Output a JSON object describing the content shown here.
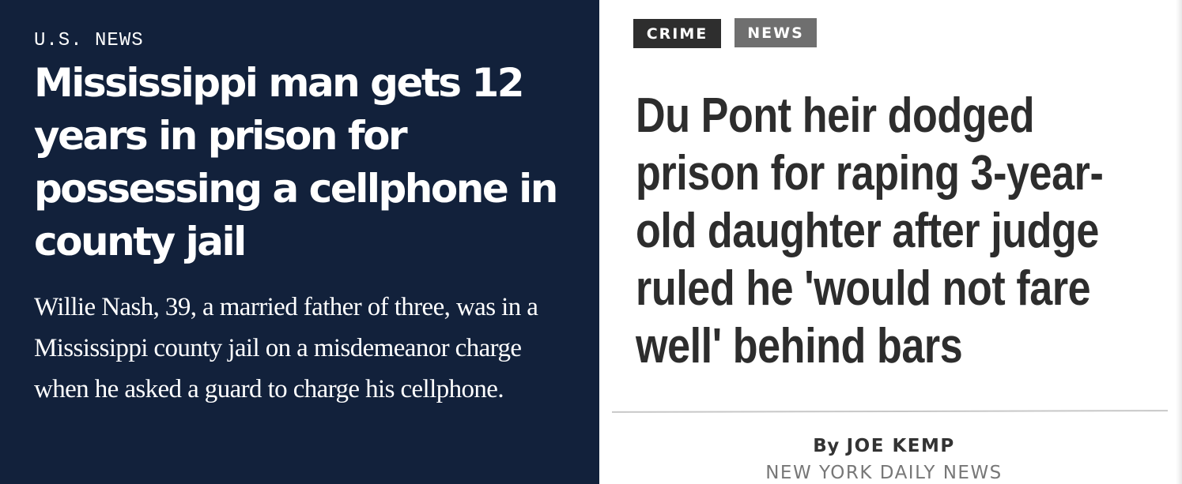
{
  "left_article": {
    "section": "U.S. NEWS",
    "headline": "Mississippi man gets 12 years in prison for possessing a cellphone in county jail",
    "summary": "Willie Nash, 39, a married father of three, was in a Mississippi county jail on a misdemeanor charge when he asked a guard to charge his cellphone."
  },
  "right_article": {
    "tags": [
      "CRIME",
      "NEWS"
    ],
    "headline": "Du Pont heir dodged prison for raping 3-year-old daughter after judge ruled he 'would not fare well' behind bars",
    "byline_prefix": "By",
    "author": "JOE KEMP",
    "source": "NEW YORK DAILY NEWS"
  },
  "colors": {
    "left_background": "#12213b",
    "crime_tag": "#2e2e2e",
    "news_tag": "#6f6f6f",
    "right_headline": "#2d2d2d"
  }
}
